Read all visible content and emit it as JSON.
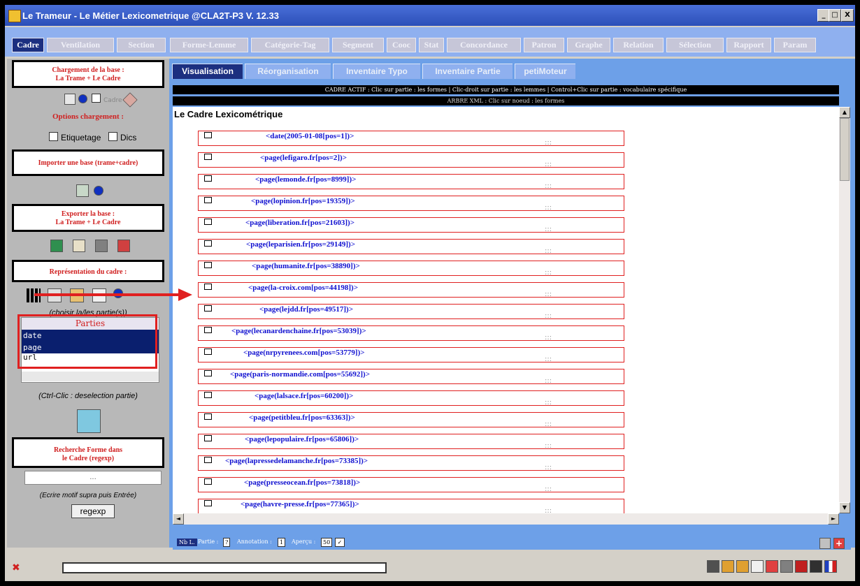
{
  "window": {
    "title": "Le Trameur - Le Métier Lexicometrique @CLA2T-P3 V. 12.33",
    "minimize": "_",
    "maximize": "□",
    "close": "X"
  },
  "main_tabs": [
    "Cadre",
    "Ventilation",
    "Section",
    "Forme-Lemme",
    "Catégorie-Tag",
    "Segment",
    "Cooc",
    "Stat",
    "Concordance",
    "Patron",
    "Graphe",
    "Relation",
    "Sélection",
    "Rapport",
    "Param"
  ],
  "sidebar": {
    "load_title_1": "Chargement de la base :",
    "load_title_2": "La Trame + Le Cadre",
    "cadre_check_label": "Cadre",
    "options_title": "Options chargement :",
    "etiquetage_label": "Etiquetage",
    "dics_label": "Dics",
    "import_title": "Importer une base (trame+cadre)",
    "export_title_1": "Exporter la base :",
    "export_title_2": "La Trame + Le Cadre",
    "repr_title": "Représentation du cadre :",
    "choose_hint": "(choisir la/les partie(s))",
    "parts_header": "Parties",
    "parts": [
      "date",
      "page",
      "url"
    ],
    "ctrl_hint": "(Ctrl-Clic : deselection partie)",
    "search_title_1": "Recherche Forme dans",
    "search_title_2": "le Cadre (regexp)",
    "search_value": "...",
    "search_hint": "(Ecrire motif supra puis Entrée)",
    "regexp_button": "regexp"
  },
  "sub_tabs": [
    "Visualisation",
    "Réorganisation",
    "Inventaire Typo",
    "Inventaire Partie",
    "petiMoteur"
  ],
  "info_line_1": "CADRE ACTIF : Clic sur partie : les formes | Clic-droit sur partie : les lemmes | Control+Clic sur partie : vocabulaire spécifique",
  "info_line_2": "ARBRE XML : Clic sur noeud : les formes",
  "content_title": "Le Cadre Lexicométrique",
  "rows": [
    {
      "label": "<date(2005-01-08[pos=1])>"
    },
    {
      "label": "<page(lefigaro.fr[pos=2])>"
    },
    {
      "label": "<page(lemonde.fr[pos=8999])>"
    },
    {
      "label": "<page(lopinion.fr[pos=19359])>"
    },
    {
      "label": "<page(liberation.fr[pos=21603])>"
    },
    {
      "label": "<page(leparisien.fr[pos=29149])>"
    },
    {
      "label": "<page(humanite.fr[pos=38890])>"
    },
    {
      "label": "<page(la-croix.com[pos=44198])>"
    },
    {
      "label": "<page(lejdd.fr[pos=49517])>"
    },
    {
      "label": "<page(lecanardenchaine.fr[pos=53039])>"
    },
    {
      "label": "<page(nrpyrenees.com[pos=53779])>"
    },
    {
      "label": "<page(paris-normandie.com[pos=55692])>"
    },
    {
      "label": "<page(lalsace.fr[pos=60200])>"
    },
    {
      "label": "<page(petitbleu.fr[pos=63363])>"
    },
    {
      "label": "<page(lepopulaire.fr[pos=65806])>"
    },
    {
      "label": "<page(lapressedelamanche.fr[pos=73385])>"
    },
    {
      "label": "<page(presseocean.fr[pos=73818])>"
    },
    {
      "label": "<page(havre-presse.fr[pos=77365])>"
    }
  ],
  "row_dots": ":::",
  "bottom": {
    "nbl": "Nb L.",
    "partie_label": "Partie :",
    "partie_value": "?",
    "annotation_label": "Annotation :",
    "annotation_value": "1",
    "apercu_label": "Aperçu :",
    "apercu_value": "50"
  },
  "colors": {
    "title": "#2b4fb8",
    "tab_active": "#1c2f80",
    "panel_blue": "#6da0e8",
    "accent_red": "#d02020"
  }
}
